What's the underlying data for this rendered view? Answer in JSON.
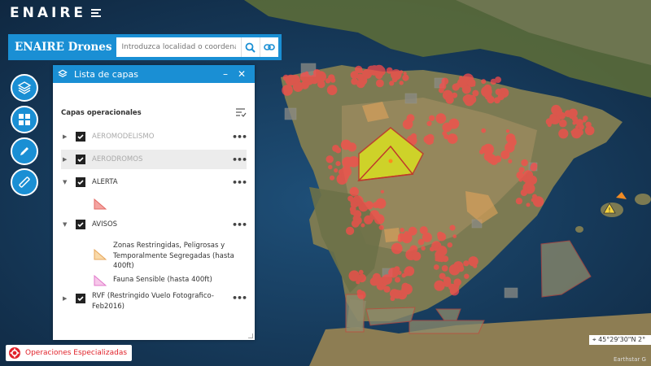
{
  "brand": {
    "logo_text": "ENAIRE"
  },
  "search": {
    "app_title": "ENAIRE Drones",
    "placeholder": "Introduzca localidad o coordenadas",
    "search_icon": "search-icon",
    "link_icon": "link-icon"
  },
  "toolbar": {
    "items": [
      "layers-icon",
      "grid-icon",
      "pencil-icon",
      "ruler-icon"
    ]
  },
  "panel": {
    "title": "Lista de capas",
    "minimize": "–",
    "close": "✕",
    "section_title": "Capas operacionales",
    "layers": [
      {
        "label": "AEROMODELISMO",
        "checked": true
      },
      {
        "label": "AERODROMOS",
        "checked": true
      },
      {
        "label": "ALERTA",
        "checked": true
      },
      {
        "label": "AVISOS",
        "checked": true
      },
      {
        "label": "RVF (Restringido Vuelo Fotografico-Feb2016)",
        "checked": true
      }
    ],
    "more_label": "•••",
    "legend": [
      {
        "label": "",
        "color": "#f4a3a0"
      },
      {
        "label": "Zonas Restringidas, Peligrosas y Temporalmente Segregadas (hasta 400ft)",
        "color": "#f9d9a8"
      },
      {
        "label": "Fauna Sensible (hasta 400ft)",
        "color": "#f7c7ea"
      }
    ]
  },
  "operations_button": {
    "label": "Operaciones Especializadas",
    "color": "#e1222a"
  },
  "map": {
    "coordinates": "45°29'30\"N 2°",
    "attribution": "Earthstar G"
  },
  "colors": {
    "accent": "#1a8fd4",
    "zone_red": "#ff4a4a",
    "zone_yellow": "#d9e021"
  }
}
